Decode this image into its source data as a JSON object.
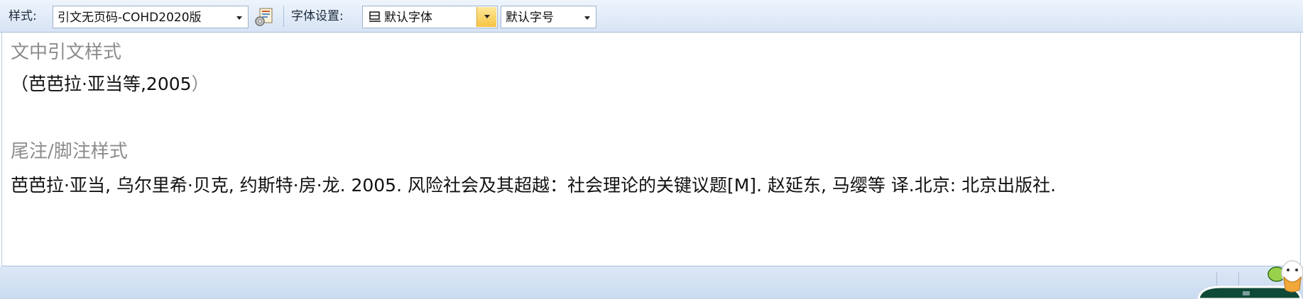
{
  "toolbar": {
    "style_label": "样式:",
    "style_value": "引文无页码-COHD2020版",
    "style_settings_icon": "settings-icon",
    "font_label": "字体设置:",
    "font_family_value": "默认字体",
    "font_size_value": "默认字号"
  },
  "in_text": {
    "title": "文中引文样式",
    "open_paren": "（",
    "citation": "芭芭拉·亚当等,2005",
    "close_paren": "）"
  },
  "footnote": {
    "title": "尾注/脚注样式",
    "reference": "芭芭拉·亚当, 乌尔里希·贝克, 约斯特·房·龙. 2005. 风险社会及其超越：社会理论的关键议题[M]. 赵延东, 马缨等 译.北京: 北京出版社."
  },
  "colors": {
    "toolbar_bg": "#d7e4f5",
    "section_title": "#8c8c8c",
    "body_text": "#111111",
    "dropdown_accent": "#f6c443"
  }
}
